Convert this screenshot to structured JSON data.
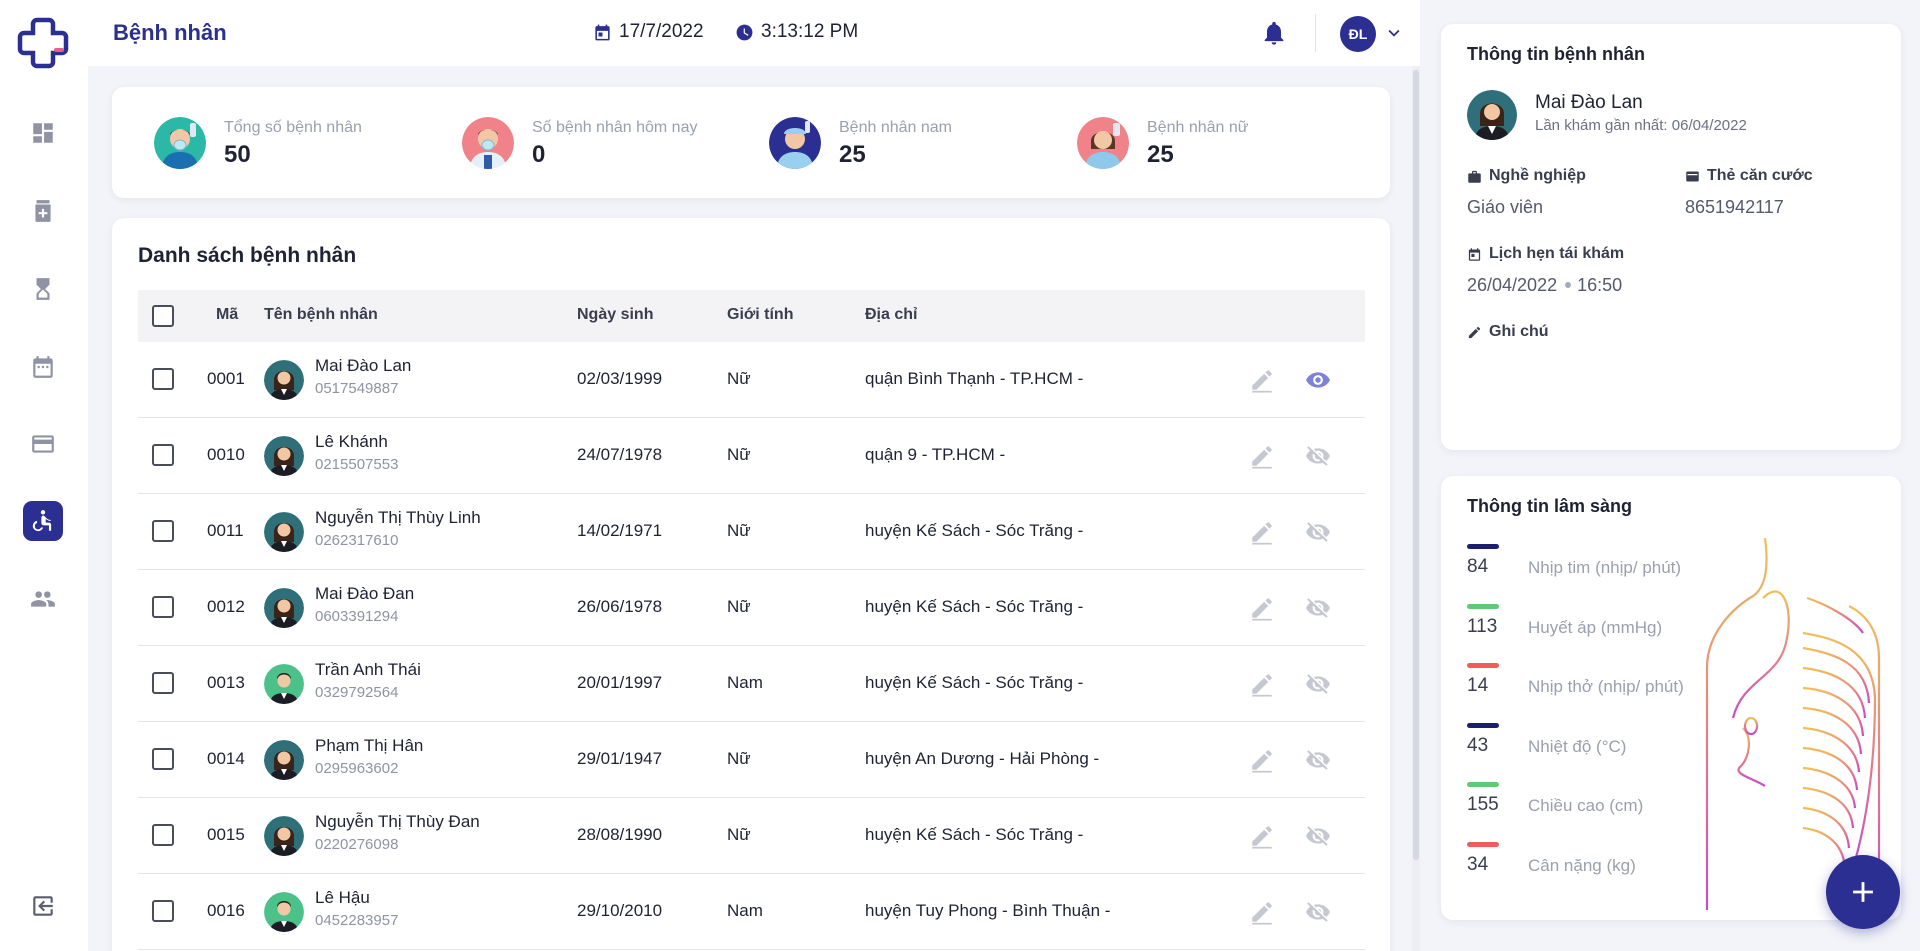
{
  "header": {
    "title": "Bệnh nhân",
    "date": "17/7/2022",
    "time": "3:13:12 PM",
    "user_initials": "ĐL"
  },
  "sidebar": {
    "items": [
      {
        "name": "dashboard",
        "icon": "dashboard-icon"
      },
      {
        "name": "medical",
        "icon": "medical-kit-icon"
      },
      {
        "name": "queue",
        "icon": "hourglass-icon"
      },
      {
        "name": "schedule",
        "icon": "calendar-icon"
      },
      {
        "name": "payment",
        "icon": "credit-card-icon"
      },
      {
        "name": "patients",
        "icon": "accessible-icon",
        "active": true
      },
      {
        "name": "staff",
        "icon": "people-icon"
      }
    ],
    "logout_icon": "logout-icon"
  },
  "stats": [
    {
      "label": "Tổng số bệnh nhân",
      "value": "50"
    },
    {
      "label": "Số bệnh nhân hôm nay",
      "value": "0"
    },
    {
      "label": "Bệnh nhân nam",
      "value": "25"
    },
    {
      "label": "Bệnh nhân nữ",
      "value": "25"
    }
  ],
  "patient_list": {
    "title": "Danh sách bệnh nhân",
    "columns": {
      "code": "Mã",
      "name": "Tên bệnh nhân",
      "dob": "Ngày sinh",
      "gender": "Giới tính",
      "address": "Địa chỉ"
    },
    "rows": [
      {
        "code": "0001",
        "name": "Mai Đào Lan",
        "phone": "0517549887",
        "dob": "02/03/1999",
        "gender": "Nữ",
        "address": "quận Bình Thạnh - TP.HCM -",
        "visible": true
      },
      {
        "code": "0010",
        "name": "Lê Khánh",
        "phone": "0215507553",
        "dob": "24/07/1978",
        "gender": "Nữ",
        "address": "quận 9 - TP.HCM -",
        "visible": false
      },
      {
        "code": "0011",
        "name": "Nguyễn Thị Thùy Linh",
        "phone": "0262317610",
        "dob": "14/02/1971",
        "gender": "Nữ",
        "address": "huyện Kế Sách - Sóc Trăng -",
        "visible": false
      },
      {
        "code": "0012",
        "name": "Mai Đào Đan",
        "phone": "0603391294",
        "dob": "26/06/1978",
        "gender": "Nữ",
        "address": "huyện Kế Sách - Sóc Trăng -",
        "visible": false
      },
      {
        "code": "0013",
        "name": "Trần Anh Thái",
        "phone": "0329792564",
        "dob": "20/01/1997",
        "gender": "Nam",
        "address": "huyện Kế Sách - Sóc Trăng -",
        "visible": false
      },
      {
        "code": "0014",
        "name": "Phạm Thị Hân",
        "phone": "0295963602",
        "dob": "29/01/1947",
        "gender": "Nữ",
        "address": "huyện An Dương - Hải Phòng -",
        "visible": false
      },
      {
        "code": "0015",
        "name": "Nguyễn Thị Thùy Đan",
        "phone": "0220276098",
        "dob": "28/08/1990",
        "gender": "Nữ",
        "address": "huyện Kế Sách - Sóc Trăng -",
        "visible": false
      },
      {
        "code": "0016",
        "name": "Lê Hậu",
        "phone": "0452283957",
        "dob": "29/10/2010",
        "gender": "Nam",
        "address": "huyện Tuy Phong - Bình Thuận -",
        "visible": false
      }
    ]
  },
  "patient_info": {
    "title": "Thông tin bệnh nhân",
    "name": "Mai Đào Lan",
    "last_visit": "Lần khám gần nhất: 06/04/2022",
    "job_label": "Nghề nghiệp",
    "job": "Giáo viên",
    "id_label": "Thẻ căn cước",
    "id_number": "8651942117",
    "appointment_label": "Lịch hẹn tái khám",
    "appointment_date": "26/04/2022",
    "appointment_time": "16:50",
    "note_label": "Ghi chú"
  },
  "clinical": {
    "title": "Thông tin lâm sàng",
    "vitals": [
      {
        "value": "84",
        "label": "Nhịp tim (nhịp/ phút)",
        "color": "#1c1f6e"
      },
      {
        "value": "113",
        "label": "Huyết áp (mmHg)",
        "color": "#5fc973"
      },
      {
        "value": "14",
        "label": "Nhịp thở (nhịp/ phút)",
        "color": "#f25b5b"
      },
      {
        "value": "43",
        "label": "Nhiệt độ (°C)",
        "color": "#1c1f6e"
      },
      {
        "value": "155",
        "label": "Chiều cao (cm)",
        "color": "#5fc973"
      },
      {
        "value": "34",
        "label": "Cân nặng (kg)",
        "color": "#f25b5b"
      }
    ]
  },
  "colors": {
    "primary": "#2b2f91",
    "background": "#f3f4f9"
  }
}
